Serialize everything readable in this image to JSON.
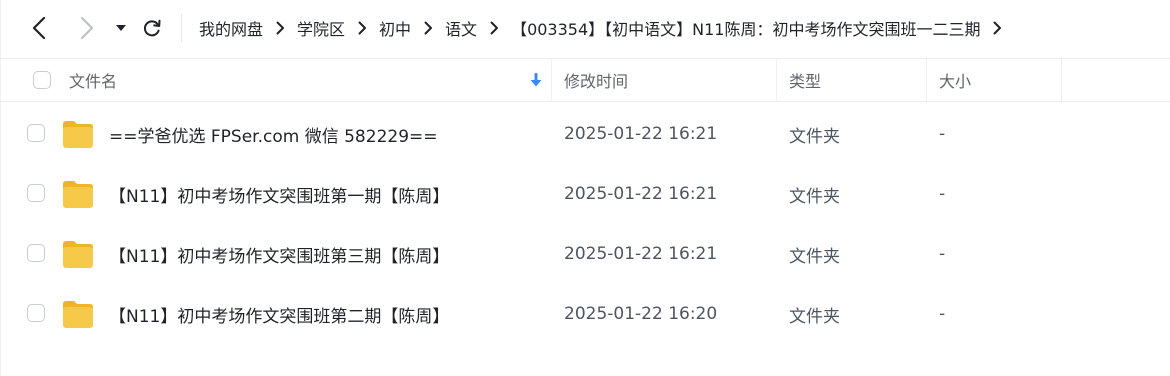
{
  "nav": {
    "back_icon": "chevron-left-icon",
    "forward_icon": "chevron-right-icon",
    "history_icon": "caret-down-icon",
    "refresh_icon": "refresh-icon"
  },
  "breadcrumb": [
    {
      "label": "我的网盘"
    },
    {
      "label": "学院区"
    },
    {
      "label": "初中"
    },
    {
      "label": "语文"
    },
    {
      "label": "【003354】【初中语文】N11陈周：初中考场作文突围班一二三期"
    }
  ],
  "table": {
    "columns": {
      "name": "文件名",
      "mtime": "修改时间",
      "type": "类型",
      "size": "大小"
    },
    "sort_icon": "sort-down-arrow-icon",
    "rows": [
      {
        "name": "==学爸优选 FPSer.com 微信 582229==",
        "mtime": "2025-01-22 16:21",
        "type": "文件夹",
        "size": "-"
      },
      {
        "name": "【N11】初中考场作文突围班第一期【陈周】",
        "mtime": "2025-01-22 16:21",
        "type": "文件夹",
        "size": "-"
      },
      {
        "name": "【N11】初中考场作文突围班第三期【陈周】",
        "mtime": "2025-01-22 16:21",
        "type": "文件夹",
        "size": "-"
      },
      {
        "name": "【N11】初中考场作文突围班第二期【陈周】",
        "mtime": "2025-01-22 16:20",
        "type": "文件夹",
        "size": "-"
      }
    ]
  },
  "colors": {
    "accent": "#3b8bf5",
    "folder": "#f7c948",
    "folder_dark": "#f0b429"
  }
}
